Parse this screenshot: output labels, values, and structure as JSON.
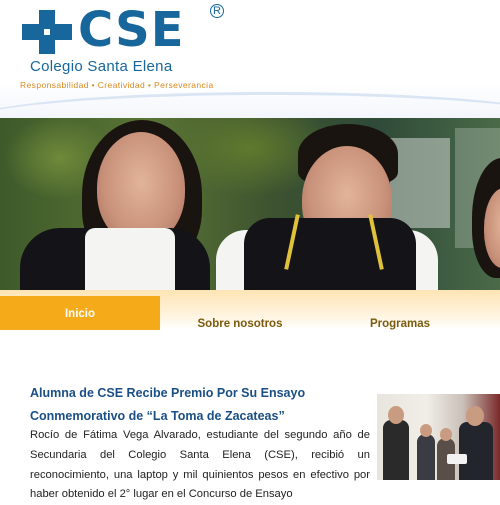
{
  "header": {
    "logo_text": "CSE",
    "logo_registered": "R",
    "school_name": "Colegio Santa Elena",
    "tagline": "Responsabilidad • Creatividad • Perseverancia"
  },
  "hero": {
    "image": "students-photo"
  },
  "nav": {
    "items": [
      {
        "label": "Inicio",
        "active": true
      },
      {
        "label": "Sobre nosotros",
        "active": false
      },
      {
        "label": "Programas",
        "active": false
      }
    ]
  },
  "article": {
    "title": "Alumna de CSE Recibe Premio Por Su Ensayo Conmemorativo de “La Toma de Zacateas”",
    "body": "Rocío de Fátima Vega Alvarado, estudiante del segundo año de Secundaria del Colegio Santa Elena (CSE), recibió un reconocimiento, una laptop y mil quinientos pesos en efectivo por haber obtenido el 2° lugar en el Concurso de Ensayo",
    "image": "award-ceremony-photo"
  },
  "colors": {
    "brand_blue": "#17679c",
    "accent_orange": "#f5aa1a",
    "tagline_orange": "#d9891e",
    "title_blue": "#1a4f86"
  }
}
